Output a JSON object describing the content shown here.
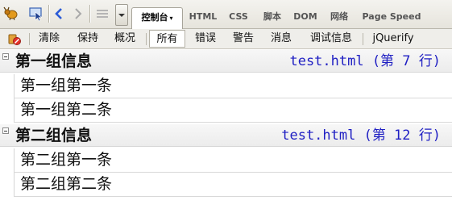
{
  "toolbar": {
    "tabs": [
      {
        "label": "控制台",
        "active": true
      },
      {
        "label": "HTML"
      },
      {
        "label": "CSS"
      },
      {
        "label": "脚本"
      },
      {
        "label": "DOM"
      },
      {
        "label": "网络"
      },
      {
        "label": "Page Speed"
      }
    ],
    "caret": "▾"
  },
  "filters": [
    "清除",
    "保持",
    "概况",
    "所有",
    "错误",
    "警告",
    "消息",
    "调试信息",
    "jQuerify"
  ],
  "console": {
    "groups": [
      {
        "title": "第一组信息",
        "location": "test.html (第 7 行)",
        "rows": [
          "第一组第一条",
          "第一组第二条"
        ]
      },
      {
        "title": "第二组信息",
        "location": "test.html (第 12 行)",
        "rows": [
          "第二组第一条",
          "第二组第二条"
        ]
      }
    ]
  },
  "colors": {
    "location": "#1f1fc3",
    "toolbar": "#e6e4dc",
    "accent_blue": "#2a5bd7"
  }
}
